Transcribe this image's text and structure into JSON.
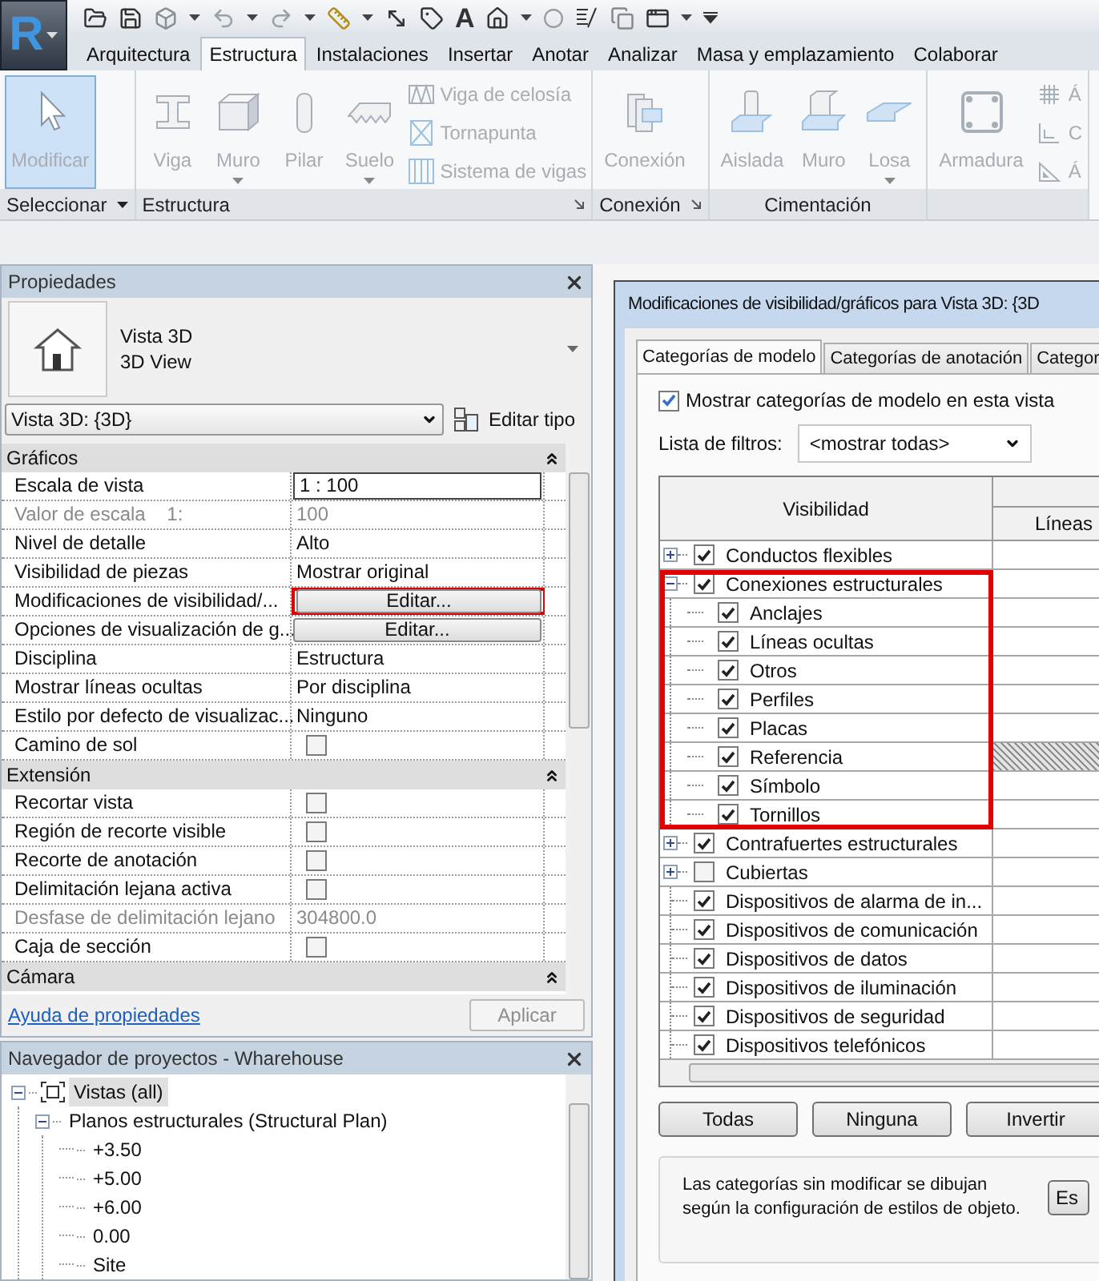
{
  "app_button": {
    "letter": "R"
  },
  "quick_access": {
    "text_tool": "A"
  },
  "ribbon_tabs": [
    {
      "label": "Arquitectura",
      "selected": false
    },
    {
      "label": "Estructura",
      "selected": true
    },
    {
      "label": "Instalaciones",
      "selected": false
    },
    {
      "label": "Insertar",
      "selected": false
    },
    {
      "label": "Anotar",
      "selected": false
    },
    {
      "label": "Analizar",
      "selected": false
    },
    {
      "label": "Masa y emplazamiento",
      "selected": false
    },
    {
      "label": "Colaborar",
      "selected": false
    }
  ],
  "ribbon_groups": [
    {
      "label": "Seleccionar",
      "has_menu": true,
      "launcher": false,
      "large_tools": [
        {
          "label": "Modificar",
          "selected": true,
          "disabled": true,
          "has_menu": false
        }
      ]
    },
    {
      "label": "Estructura",
      "has_menu": false,
      "launcher": true,
      "large_tools": [
        {
          "label": "Viga",
          "selected": false,
          "disabled": true,
          "has_menu": false
        },
        {
          "label": "Muro",
          "selected": false,
          "disabled": true,
          "has_menu": true
        },
        {
          "label": "Pilar",
          "selected": false,
          "disabled": true,
          "has_menu": false
        },
        {
          "label": "Suelo",
          "selected": false,
          "disabled": true,
          "has_menu": true
        }
      ],
      "small_tools": [
        {
          "label": "Viga de celosía",
          "disabled": true
        },
        {
          "label": "Tornapunta",
          "disabled": true
        },
        {
          "label": "Sistema de vigas",
          "disabled": true
        }
      ]
    },
    {
      "label": "Conexión",
      "has_menu": false,
      "launcher": true,
      "large_tools": [
        {
          "label": "Conexión",
          "selected": false,
          "disabled": true,
          "has_menu": false
        }
      ]
    },
    {
      "label": "Cimentación",
      "has_menu": false,
      "launcher": false,
      "large_tools": [
        {
          "label": "Aislada",
          "selected": false,
          "disabled": true,
          "has_menu": false
        },
        {
          "label": "Muro",
          "selected": false,
          "disabled": true,
          "has_menu": false
        },
        {
          "label": "Losa",
          "selected": false,
          "disabled": true,
          "has_menu": true
        }
      ]
    },
    {
      "has_menu": false,
      "launcher": false,
      "large_tools": [
        {
          "label": "Armadura",
          "selected": false,
          "disabled": true,
          "has_menu": false
        }
      ],
      "small_tools": [
        {
          "label": "Á",
          "disabled": true
        },
        {
          "label": "C",
          "disabled": true
        },
        {
          "label": "Á",
          "disabled": true
        }
      ]
    }
  ],
  "properties": {
    "title": "Propiedades",
    "type_name": "Vista 3D",
    "type_subname": "3D View",
    "instance_selector": "Vista 3D: {3D}",
    "edit_type": "Editar tipo",
    "sections": [
      {
        "title": "Gráficos",
        "expanded": true,
        "rows": [
          {
            "label": "Escala de vista",
            "kind": "input",
            "value": "1 : 100",
            "disabled": false,
            "highlighted": false
          },
          {
            "label": "Valor de escala    1:",
            "kind": "text",
            "value": "100",
            "disabled": true,
            "highlighted": false
          },
          {
            "label": "Nivel de detalle",
            "kind": "text",
            "value": "Alto",
            "disabled": false,
            "highlighted": false
          },
          {
            "label": "Visibilidad de piezas",
            "kind": "text",
            "value": "Mostrar original",
            "disabled": false,
            "highlighted": false
          },
          {
            "label": "Modificaciones de visibilidad/...",
            "kind": "button",
            "value": "Editar...",
            "disabled": false,
            "highlighted": true
          },
          {
            "label": "Opciones de visualización de g...",
            "kind": "button",
            "value": "Editar...",
            "disabled": false,
            "highlighted": false
          },
          {
            "label": "Disciplina",
            "kind": "text",
            "value": "Estructura",
            "disabled": false,
            "highlighted": false
          },
          {
            "label": "Mostrar líneas ocultas",
            "kind": "text",
            "value": "Por disciplina",
            "disabled": false,
            "highlighted": false
          },
          {
            "label": "Estilo por defecto de visualizac...",
            "kind": "text",
            "value": "Ninguno",
            "disabled": false,
            "highlighted": false
          },
          {
            "label": "Camino de sol",
            "kind": "checkbox",
            "checked": false,
            "disabled": false,
            "highlighted": false
          }
        ]
      },
      {
        "title": "Extensión",
        "expanded": true,
        "rows": [
          {
            "label": "Recortar vista",
            "kind": "checkbox",
            "checked": false,
            "disabled": false,
            "highlighted": false
          },
          {
            "label": "Región de recorte visible",
            "kind": "checkbox",
            "checked": false,
            "disabled": false,
            "highlighted": false
          },
          {
            "label": "Recorte de anotación",
            "kind": "checkbox",
            "checked": false,
            "disabled": false,
            "highlighted": false
          },
          {
            "label": "Delimitación lejana activa",
            "kind": "checkbox",
            "checked": false,
            "disabled": false,
            "highlighted": false
          },
          {
            "label": "Desfase de delimitación lejano",
            "kind": "text",
            "value": "304800.0",
            "disabled": true,
            "highlighted": false
          },
          {
            "label": "Caja de sección",
            "kind": "checkbox",
            "checked": false,
            "disabled": false,
            "highlighted": false
          }
        ]
      },
      {
        "title": "Cámara",
        "expanded": true
      }
    ],
    "help_link": "Ayuda de propiedades",
    "apply_button": {
      "label": "Aplicar",
      "disabled": true
    }
  },
  "project_browser": {
    "title": "Navegador de proyectos - Wharehouse",
    "tree": [
      {
        "label": "Vistas (all)",
        "selected": true,
        "expanded": true,
        "children": [
          {
            "label": "Planos estructurales (Structural Plan)",
            "selected": false,
            "expanded": true,
            "children": [
              {
                "label": "+3.50",
                "selected": false
              },
              {
                "label": "+5.00",
                "selected": false
              },
              {
                "label": "+6.00",
                "selected": false
              },
              {
                "label": "0.00",
                "selected": false
              },
              {
                "label": "Site",
                "selected": false
              }
            ]
          }
        ]
      }
    ]
  },
  "dialog": {
    "title": "Modificaciones de visibilidad/gráficos para Vista 3D: {3D",
    "tabs": [
      {
        "label": "Categorías de modelo",
        "selected": true
      },
      {
        "label": "Categorías de anotación",
        "selected": false
      },
      {
        "label": "Categor",
        "selected": false
      }
    ],
    "show_categories": {
      "label": "Mostrar categorías de modelo en esta vista",
      "checked": true
    },
    "filter_list": {
      "label": "Lista de filtros:",
      "value": "<mostrar todas>"
    },
    "table": {
      "columns": [
        "Visibilidad",
        "Líneas"
      ],
      "rows": [
        {
          "label": "Conductos flexibles",
          "kind": "group",
          "expanded": false,
          "checked": true,
          "highlighted": false,
          "lines_hatched": false
        },
        {
          "label": "Conexiones estructurales",
          "kind": "group",
          "expanded": true,
          "checked": true,
          "highlighted": true,
          "lines_hatched": false,
          "children": [
            {
              "label": "Anclajes",
              "checked": true,
              "lines_hatched": false
            },
            {
              "label": "Líneas ocultas",
              "checked": true,
              "lines_hatched": false
            },
            {
              "label": "Otros",
              "checked": true,
              "lines_hatched": false
            },
            {
              "label": "Perfiles",
              "checked": true,
              "lines_hatched": false
            },
            {
              "label": "Placas",
              "checked": true,
              "lines_hatched": false
            },
            {
              "label": "Referencia",
              "checked": true,
              "lines_hatched": true
            },
            {
              "label": "Símbolo",
              "checked": true,
              "lines_hatched": false
            },
            {
              "label": "Tornillos",
              "checked": true,
              "lines_hatched": false
            }
          ]
        },
        {
          "label": "Contrafuertes estructurales",
          "kind": "group",
          "expanded": false,
          "checked": true,
          "highlighted": false,
          "lines_hatched": false
        },
        {
          "label": "Cubiertas",
          "kind": "group",
          "expanded": false,
          "checked": false,
          "highlighted": false,
          "lines_hatched": false
        },
        {
          "label": "Dispositivos de alarma de in...",
          "kind": "leaf",
          "checked": true,
          "highlighted": false,
          "lines_hatched": false
        },
        {
          "label": "Dispositivos de comunicación",
          "kind": "leaf",
          "checked": true,
          "highlighted": false,
          "lines_hatched": false
        },
        {
          "label": "Dispositivos de datos",
          "kind": "leaf",
          "checked": true,
          "highlighted": false,
          "lines_hatched": false
        },
        {
          "label": "Dispositivos de iluminación",
          "kind": "leaf",
          "checked": true,
          "highlighted": false,
          "lines_hatched": false
        },
        {
          "label": "Dispositivos de seguridad",
          "kind": "leaf",
          "checked": true,
          "highlighted": false,
          "lines_hatched": false
        },
        {
          "label": "Dispositivos telefónicos",
          "kind": "leaf",
          "checked": true,
          "highlighted": false,
          "lines_hatched": false
        }
      ]
    },
    "buttons": [
      "Todas",
      "Ninguna",
      "Invertir"
    ],
    "note": "Las categorías sin modificar se dibujan según la configuración de estilos de objeto.",
    "note_button": "Es"
  }
}
